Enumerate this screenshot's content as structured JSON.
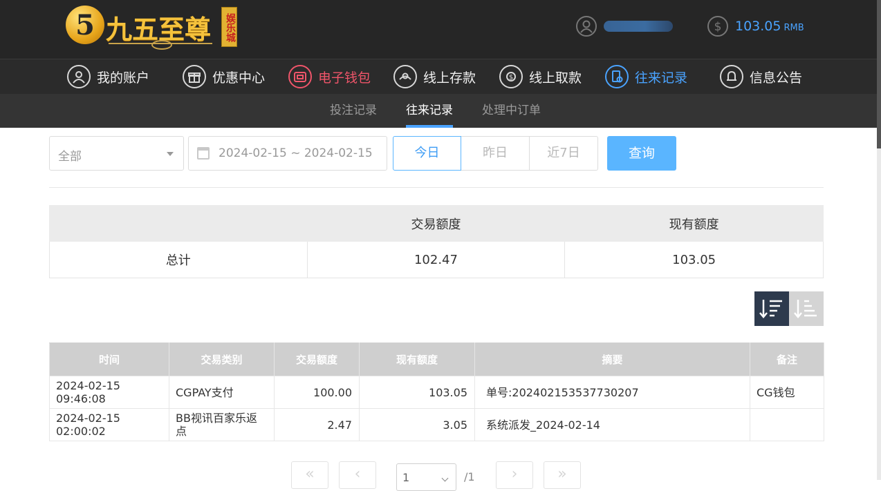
{
  "brand": {
    "numeral": "5",
    "name": "九五至尊",
    "badge": "娱乐城"
  },
  "account": {
    "balance": "103.05",
    "currency": "RMB"
  },
  "nav": {
    "items": [
      {
        "label": "我的账户",
        "icon": "user-icon"
      },
      {
        "label": "优惠中心",
        "icon": "gift-icon"
      },
      {
        "label": "电子钱包",
        "icon": "wallet-icon",
        "active_color": "#f0556a"
      },
      {
        "label": "线上存款",
        "icon": "deposit-icon"
      },
      {
        "label": "线上取款",
        "icon": "withdraw-icon"
      },
      {
        "label": "往来记录",
        "icon": "records-icon",
        "active_color": "#4aa3ff"
      },
      {
        "label": "信息公告",
        "icon": "bell-icon"
      }
    ]
  },
  "subnav": {
    "tabs": [
      {
        "label": "投注记录"
      },
      {
        "label": "往来记录",
        "active": true
      },
      {
        "label": "处理中订单"
      }
    ]
  },
  "filter": {
    "type_selected": "全部",
    "date_range": "2024-02-15 ~ 2024-02-15",
    "quick": [
      "今日",
      "昨日",
      "近7日"
    ],
    "query_label": "查询"
  },
  "summary": {
    "headers": [
      "",
      "交易额度",
      "现有额度"
    ],
    "row": {
      "label": "总计",
      "amount": "102.47",
      "balance": "103.05"
    }
  },
  "records": {
    "headers": [
      "时间",
      "交易类别",
      "交易额度",
      "现有额度",
      "摘要",
      "备注"
    ],
    "rows": [
      {
        "time": "2024-02-15 09:46:08",
        "type": "CGPAY支付",
        "amount": "100.00",
        "balance": "103.05",
        "summary": "单号:202402153537730207",
        "note": "CG钱包"
      },
      {
        "time": "2024-02-15 02:00:02",
        "type": "BB视讯百家乐返点",
        "amount": "2.47",
        "balance": "3.05",
        "summary": "系统派发_2024-02-14",
        "note": ""
      }
    ]
  },
  "pager": {
    "current": "1",
    "total": "/1"
  },
  "colors": {
    "accent_blue": "#4aa3ff",
    "accent_red": "#f0556a",
    "header_bg": "#262626"
  }
}
